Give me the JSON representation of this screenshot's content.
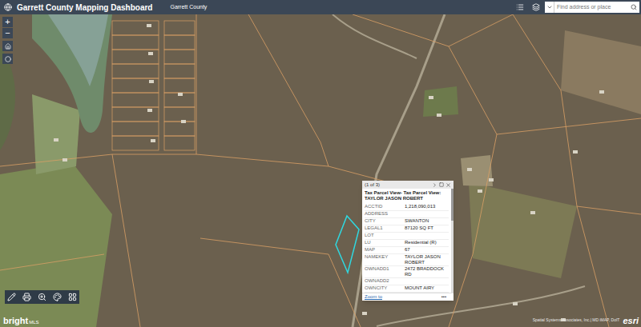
{
  "header": {
    "title": "Garrett County Mapping Dashboard",
    "subtitle": "Garrett County",
    "search": {
      "placeholder": "Find address or place"
    }
  },
  "zoom_controls": [
    "+",
    "−"
  ],
  "popup": {
    "counter": "(1 of 3)",
    "title": "Tax Parcel View- Tax Parcel View: TAYLOR JASON ROBERT",
    "fields": [
      {
        "key": "ACCTID",
        "value": "1,218,090,013"
      },
      {
        "key": "ADDRESS",
        "value": ""
      },
      {
        "key": "CITY",
        "value": "SWANTON"
      },
      {
        "key": "LEGAL1",
        "value": "87120 SQ FT"
      },
      {
        "key": "LOT",
        "value": ""
      },
      {
        "key": "LU",
        "value": "Residential (R)"
      },
      {
        "key": "MAP",
        "value": "67"
      },
      {
        "key": "NAMEKEY",
        "value": "TAYLOR JASON ROBERT"
      },
      {
        "key": "OWNADD1",
        "value": "2472 BRADDOCK RD"
      },
      {
        "key": "OWNADD2",
        "value": ""
      },
      {
        "key": "OWNCITY",
        "value": "MOUNT AIRY"
      }
    ],
    "footer": {
      "link": "Zoom to",
      "more": "•••"
    }
  },
  "watermark": {
    "brand": "bright",
    "suffix": "MLS"
  },
  "attribution": "Spatial Systems Associates, Inc.| MD iMAP, DoIT",
  "logo": "esri"
}
